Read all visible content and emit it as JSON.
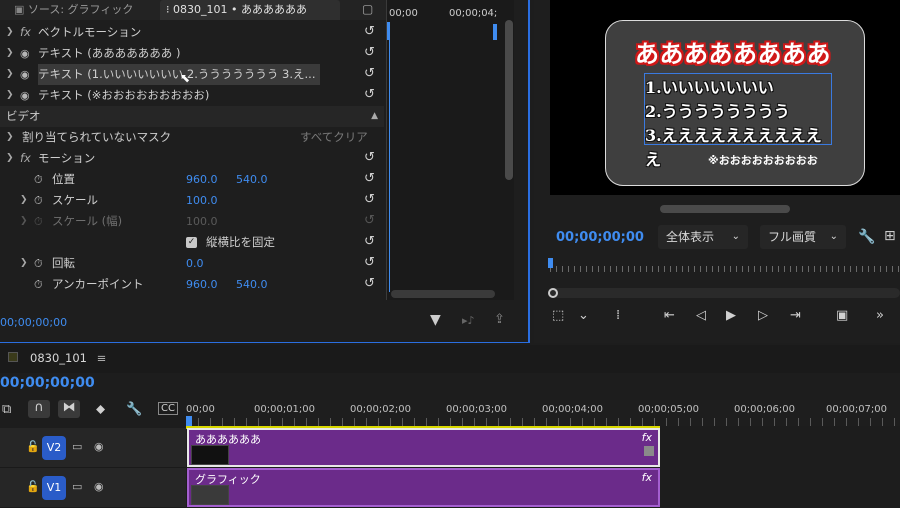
{
  "effect_controls": {
    "tab_source": "ソース: グラフィック",
    "tab_active": "0830_101 • ああああああ",
    "rows": [
      {
        "label": "ベクトルモーション"
      },
      {
        "label": "テキスト (あああああああ )"
      },
      {
        "label": "テキスト (1.いいいいいいい 2.ううううううう 3.え..."
      },
      {
        "label": "テキスト (※おおおおおおおおお)"
      }
    ],
    "section_video": "ビデオ",
    "mask_label": "割り当てられていないマスク",
    "clear_all": "すべてクリア",
    "motion_label": "モーション",
    "position_label": "位置",
    "position_x": "960.0",
    "position_y": "540.0",
    "scale_label": "スケール",
    "scale_value": "100.0",
    "scale_w_label": "スケール (幅)",
    "scale_w_value": "100.0",
    "uniform_scale": "縦横比を固定",
    "rotation_label": "回転",
    "rotation_value": "0.0",
    "anchor_label": "アンカーポイント",
    "anchor_x": "960.0",
    "anchor_y": "540.0",
    "timecode_start": "00;00",
    "timecode_end": "00;00;04;",
    "footer_timecode": "00;00;00;00"
  },
  "program_monitor": {
    "title": "ああああああああ",
    "list": [
      "1.いいいいいいい",
      "2.うううううううう",
      "3.えええええええええええ"
    ],
    "note": "※おおおおおおおおお",
    "timecode": "00;00;00;00",
    "fit": "全体表示",
    "quality": "フル画質"
  },
  "timeline": {
    "sequence": "0830_101",
    "timecode": "00;00;00;00",
    "ruler": [
      "00;00",
      "00;00;01;00",
      "00;00;02;00",
      "00;00;03;00",
      "00;00;04;00",
      "00;00;05;00",
      "00;00;06;00",
      "00;00;07;00"
    ],
    "tracks": [
      {
        "name": "V2",
        "clip": "ああああああ"
      },
      {
        "name": "V1",
        "clip": "グラフィック"
      }
    ]
  }
}
